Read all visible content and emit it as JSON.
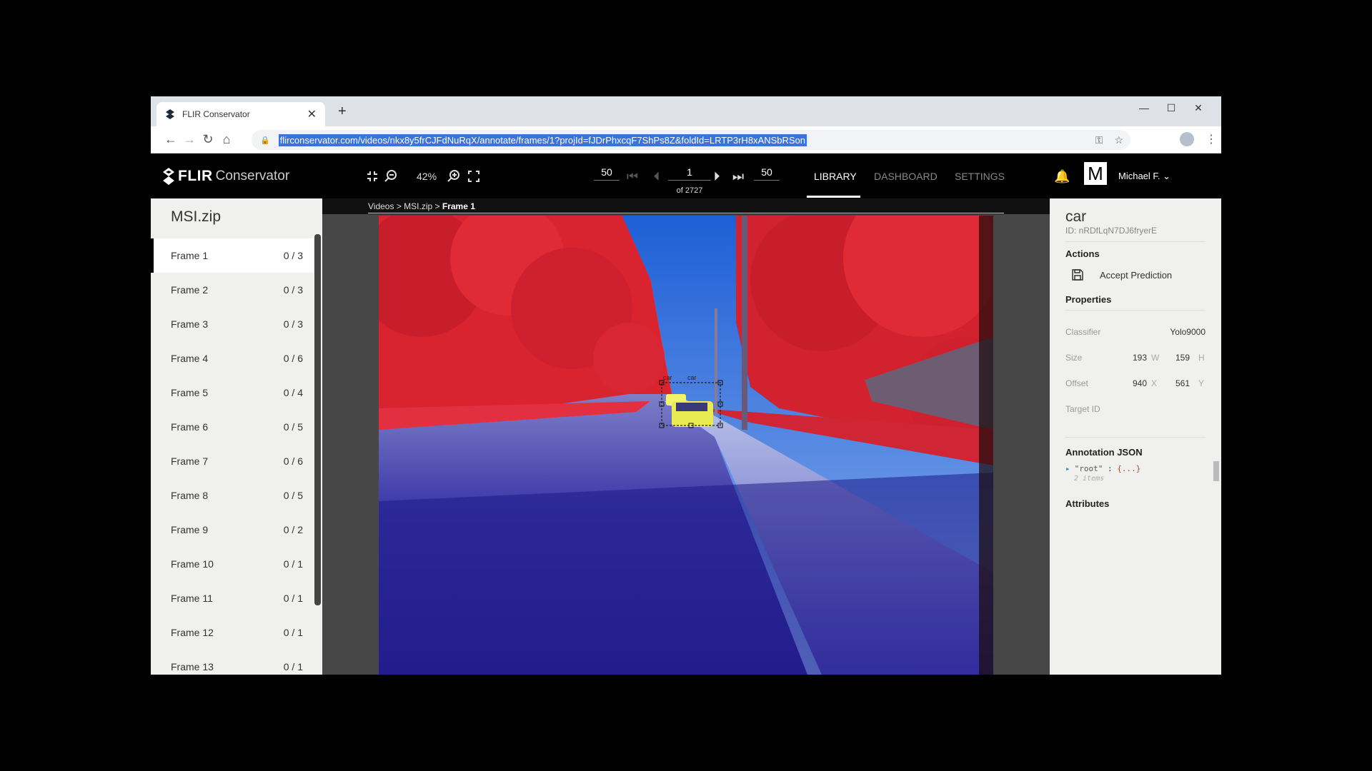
{
  "browser": {
    "tab_title": "FLIR Conservator",
    "url": "flirconservator.com/videos/nkx8y5frCJFdNuRqX/annotate/frames/1?projId=fJDrPhxcqF7ShPs8Z&foldId=LRTP3rH8xANSbRSon"
  },
  "header": {
    "logo_bold": "FLIR",
    "logo_text": "Conservator",
    "zoom": "42%",
    "step_back": "50",
    "step_forward": "50",
    "frame_current": "1",
    "frame_total": "of 2727",
    "nav": {
      "library": "LIBRARY",
      "dashboard": "DASHBOARD",
      "settings": "SETTINGS"
    },
    "user_initial": "M",
    "user_name": "Michael F."
  },
  "sidebar": {
    "title": "MSI.zip",
    "frames": [
      {
        "label": "Frame 1",
        "count": "0 / 3"
      },
      {
        "label": "Frame 2",
        "count": "0 / 3"
      },
      {
        "label": "Frame 3",
        "count": "0 / 3"
      },
      {
        "label": "Frame 4",
        "count": "0 / 6"
      },
      {
        "label": "Frame 5",
        "count": "0 / 4"
      },
      {
        "label": "Frame 6",
        "count": "0 / 5"
      },
      {
        "label": "Frame 7",
        "count": "0 / 6"
      },
      {
        "label": "Frame 8",
        "count": "0 / 5"
      },
      {
        "label": "Frame 9",
        "count": "0 / 2"
      },
      {
        "label": "Frame 10",
        "count": "0 / 1"
      },
      {
        "label": "Frame 11",
        "count": "0 / 1"
      },
      {
        "label": "Frame 12",
        "count": "0 / 1"
      },
      {
        "label": "Frame 13",
        "count": "0 / 1"
      }
    ]
  },
  "breadcrumb": {
    "root": "Videos",
    "folder": "MSI.zip",
    "current": "Frame 1"
  },
  "annotation": {
    "label_top": "car",
    "label_bottom": "car"
  },
  "panel": {
    "class_name": "car",
    "id": "ID: nRDfLqN7DJ6fryerE",
    "actions_heading": "Actions",
    "accept_label": "Accept Prediction",
    "properties_heading": "Properties",
    "classifier_label": "Classifier",
    "classifier_value": "Yolo9000",
    "size_label": "Size",
    "size_w": "193",
    "size_w_unit": "W",
    "size_h": "159",
    "size_h_unit": "H",
    "offset_label": "Offset",
    "offset_x": "940",
    "offset_x_unit": "X",
    "offset_y": "561",
    "offset_y_unit": "Y",
    "target_label": "Target ID",
    "json_heading": "Annotation JSON",
    "json_key": "\"root\"",
    "json_colon": ":",
    "json_value": "{...}",
    "json_count": "2 items",
    "attributes_heading": "Attributes"
  },
  "colors": {
    "accent": "#000000",
    "selection": "#3a74d8",
    "panel_bg": "#f0f1ee"
  }
}
